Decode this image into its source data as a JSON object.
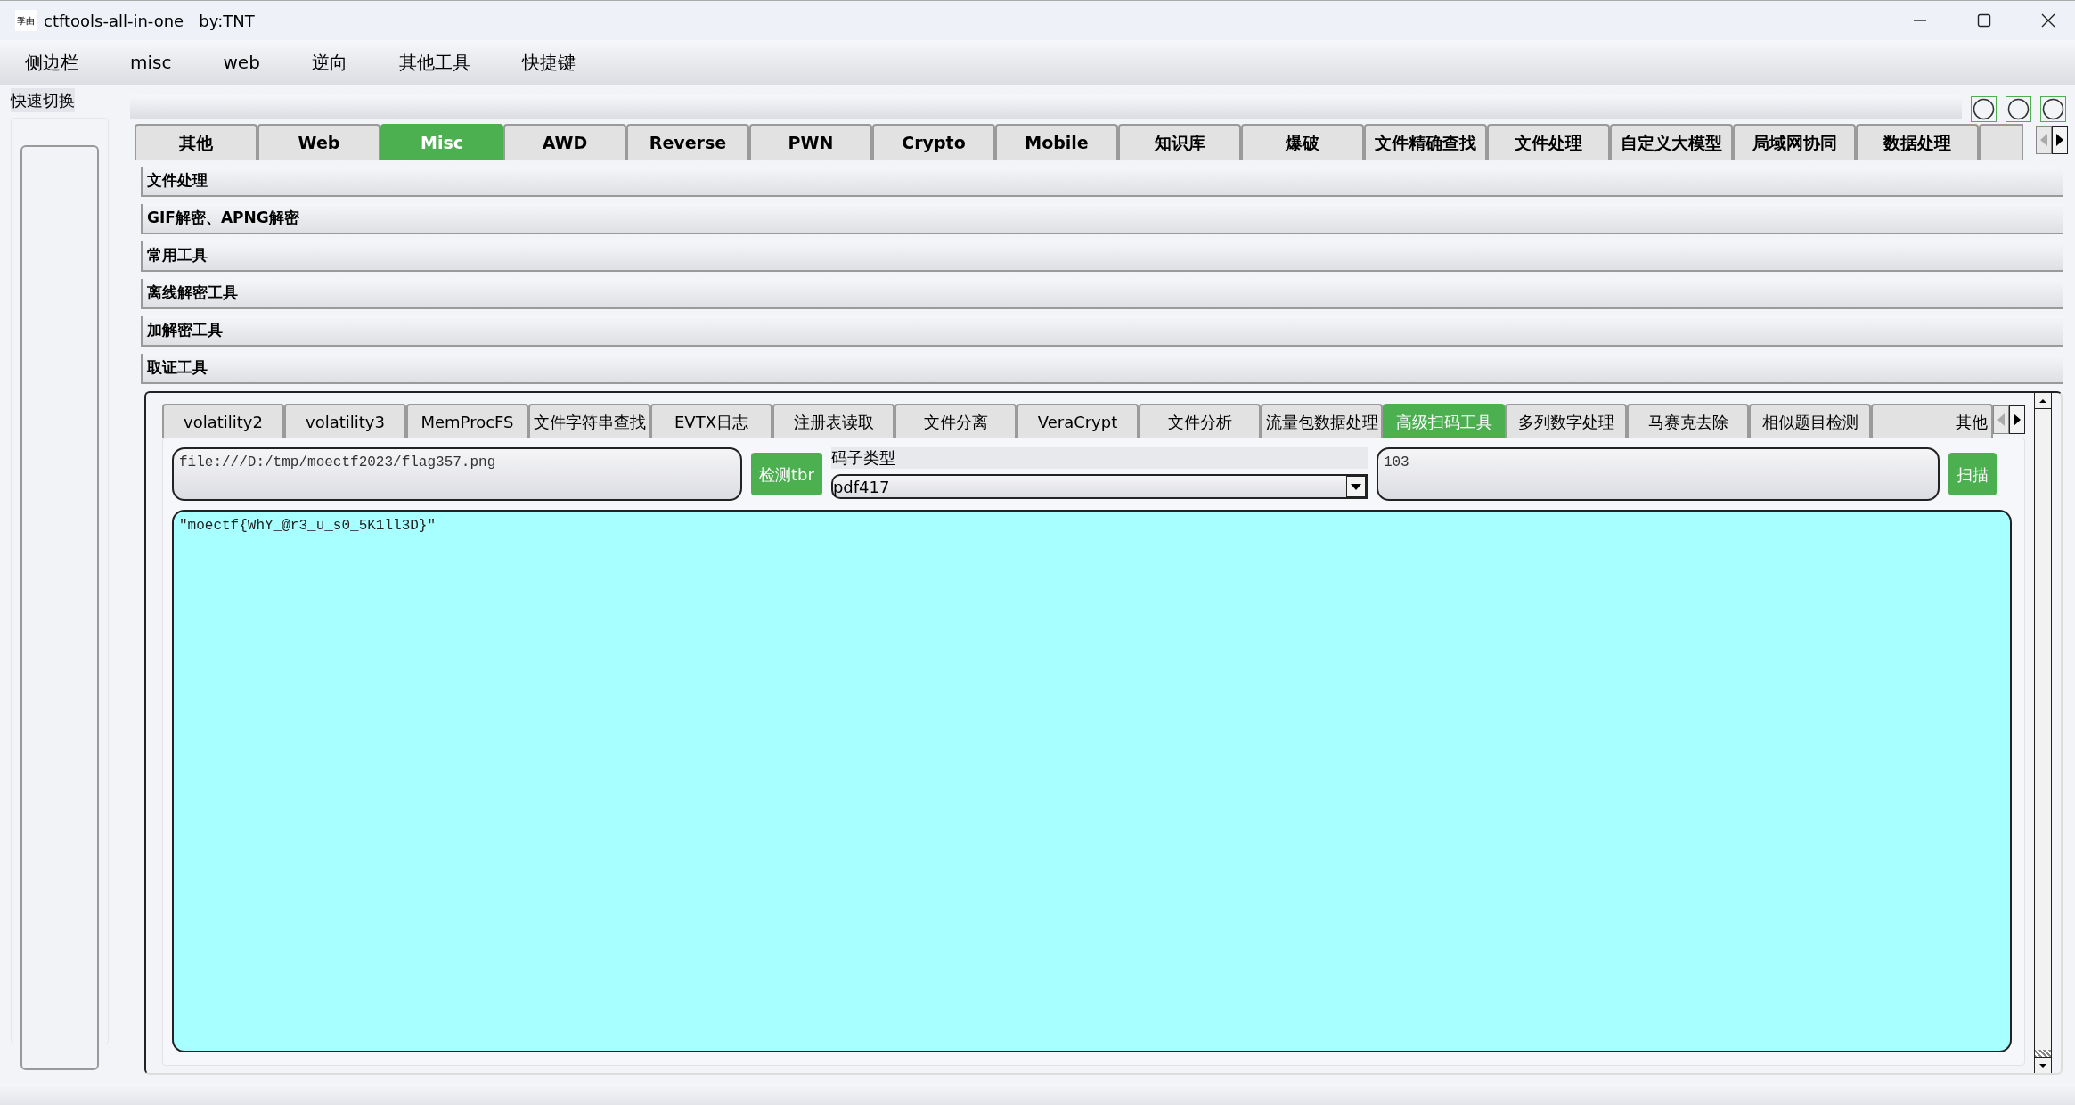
{
  "window": {
    "title": "ctftools-all-in-one   by:TNT",
    "icon_text": "季由"
  },
  "menu": [
    "侧边栏",
    "misc",
    "web",
    "逆向",
    "其他工具",
    "快捷键"
  ],
  "quick_switch": "快速切换",
  "top_tabs": [
    {
      "label": "其他",
      "selected": false
    },
    {
      "label": "Web",
      "selected": false
    },
    {
      "label": "Misc",
      "selected": true
    },
    {
      "label": "AWD",
      "selected": false
    },
    {
      "label": "Reverse",
      "selected": false
    },
    {
      "label": "PWN",
      "selected": false
    },
    {
      "label": "Crypto",
      "selected": false
    },
    {
      "label": "Mobile",
      "selected": false
    },
    {
      "label": "知识库",
      "selected": false
    },
    {
      "label": "爆破",
      "selected": false
    },
    {
      "label": "文件精确查找",
      "selected": false
    },
    {
      "label": "文件处理",
      "selected": false
    },
    {
      "label": "自定义大模型",
      "selected": false
    },
    {
      "label": "局域网协同",
      "selected": false
    },
    {
      "label": "数据处理",
      "selected": false
    }
  ],
  "sections": [
    "文件处理",
    "GIF解密、APNG解密",
    "常用工具",
    "离线解密工具",
    "加解密工具",
    "取证工具"
  ],
  "sub_tabs": [
    {
      "label": "volatility2",
      "selected": false
    },
    {
      "label": "volatility3",
      "selected": false
    },
    {
      "label": "MemProcFS",
      "selected": false
    },
    {
      "label": "文件字符串查找",
      "selected": false
    },
    {
      "label": "EVTX日志",
      "selected": false
    },
    {
      "label": "注册表读取",
      "selected": false
    },
    {
      "label": "文件分离",
      "selected": false
    },
    {
      "label": "VeraCrypt",
      "selected": false
    },
    {
      "label": "文件分析",
      "selected": false
    },
    {
      "label": "流量包数据处理",
      "selected": false
    },
    {
      "label": "高级扫码工具",
      "selected": true
    },
    {
      "label": "多列数字处理",
      "selected": false
    },
    {
      "label": "马赛克去除",
      "selected": false
    },
    {
      "label": "相似题目检测",
      "selected": false
    },
    {
      "label": "其他",
      "selected": false
    }
  ],
  "scanner": {
    "file_path": "file:///D:/tmp/moectf2023/flag357.png",
    "detect_button": "检测tbr",
    "code_type_label": "码子类型",
    "code_type": "pdf417",
    "count": "103",
    "scan_button": "扫描",
    "output": "\"moectf{WhY_@r3_u_s0_5K1ll3D}\""
  }
}
